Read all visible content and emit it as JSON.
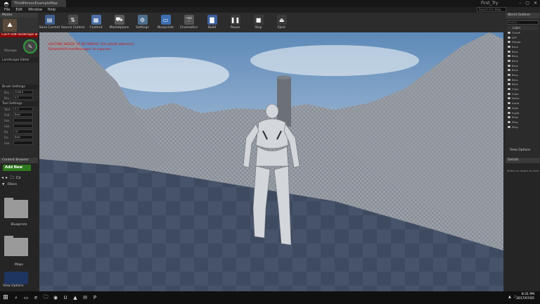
{
  "window": {
    "doc_tab": "ThirdPersonExampleMap",
    "project_name": "First_Try",
    "controls": [
      "–",
      "▢",
      "✕"
    ]
  },
  "menu": [
    "File",
    "Edit",
    "Window",
    "Help"
  ],
  "help_search": {
    "placeholder": "Search For Help"
  },
  "modes": {
    "title": "Modes",
    "warning": "Can't edit landscape w",
    "manage_label": "Manage",
    "landscape_editor": "Landscape Editor",
    "brush_settings": "Brush Settings",
    "brush_params": [
      {
        "label": "Bru",
        "value": "2048.0"
      },
      {
        "label": "Bru",
        "value": "0.5"
      }
    ],
    "tool_settings": "Tool Settings",
    "tool_params": [
      {
        "label": "Tool",
        "value": "0.3"
      },
      {
        "label": "Flat",
        "value": "Both"
      },
      {
        "label": "Use",
        "value": ""
      },
      {
        "label": "Use",
        "value": ""
      },
      {
        "label": "Ra",
        "value": "10"
      },
      {
        "label": "Fla",
        "value": "Both"
      },
      {
        "label": "Use",
        "value": ""
      }
    ]
  },
  "content_browser": {
    "tab": "Content Browser",
    "add_new": "Add New",
    "crumb": "Co",
    "filters": "Filters",
    "folders": [
      {
        "name": "Blueprints"
      },
      {
        "name": "Maps"
      }
    ],
    "view_options": "View Options"
  },
  "toolbar": [
    {
      "label": "Save Current",
      "icon": "save-icon",
      "color": "#3f5f8f",
      "glyph": "▤"
    },
    {
      "label": "Source Control",
      "icon": "source-control-icon",
      "color": "#4a4a4a",
      "glyph": "⇅"
    },
    {
      "label": "Content",
      "icon": "content-icon",
      "color": "#4c6fa8",
      "glyph": "▦"
    },
    {
      "label": "Marketplace",
      "icon": "marketplace-icon",
      "color": "#5a5a5a",
      "glyph": "⛟"
    },
    {
      "label": "Settings",
      "icon": "settings-icon",
      "color": "#4e6e8e",
      "glyph": "⚙"
    },
    {
      "label": "Blueprints",
      "icon": "blueprints-icon",
      "color": "#3d6fb0",
      "glyph": "▭"
    },
    {
      "label": "Cinematics",
      "icon": "cinematics-icon",
      "color": "#555",
      "glyph": "🎬"
    },
    {
      "label": "Build",
      "icon": "build-icon",
      "color": "#3c5f9c",
      "glyph": "▇"
    },
    {
      "label": "Pause",
      "icon": "pause-icon",
      "color": "#3a3a3a",
      "glyph": "❚❚"
    },
    {
      "label": "Stop",
      "icon": "stop-icon",
      "color": "#3a3a3a",
      "glyph": "■"
    },
    {
      "label": "Eject",
      "icon": "eject-icon",
      "color": "#3a3a3a",
      "glyph": "⏏"
    }
  ],
  "viewport": {
    "error_line": "LIGHTING NEEDS TO BE REBUILT (54 unbuilt object(s))",
    "error_sub": "'DisableAllScreenMessages' to suppress"
  },
  "world_outliner": {
    "tab": "World Outliner",
    "search_placeholder": "Search...",
    "label_header": "Label",
    "items": [
      "ThirdP",
      "ATP",
      "iFolder",
      "Brus",
      "Brus",
      "Brus",
      "Brus",
      "Brus",
      "Brus",
      "Brus",
      "Brus",
      "Brus",
      "iCam",
      "iCam",
      "iDirec",
      "iLand",
      "iLigh",
      "iLight",
      "iPlay",
      "iPlay",
      "iPlay"
    ],
    "view_options": "View Options"
  },
  "details": {
    "tab": "Details",
    "message": "Select an object to view det"
  },
  "taskbar": {
    "apps": [
      "⌕",
      "▭",
      "e",
      "🗀",
      "◉",
      "U",
      "▲",
      "✉",
      "P"
    ],
    "time": "8:31 PM",
    "date": "2017/07/05"
  },
  "colors": {
    "accent_green": "#2f7a1e",
    "error_red": "#d01010",
    "warning_bg": "#8b0000"
  }
}
